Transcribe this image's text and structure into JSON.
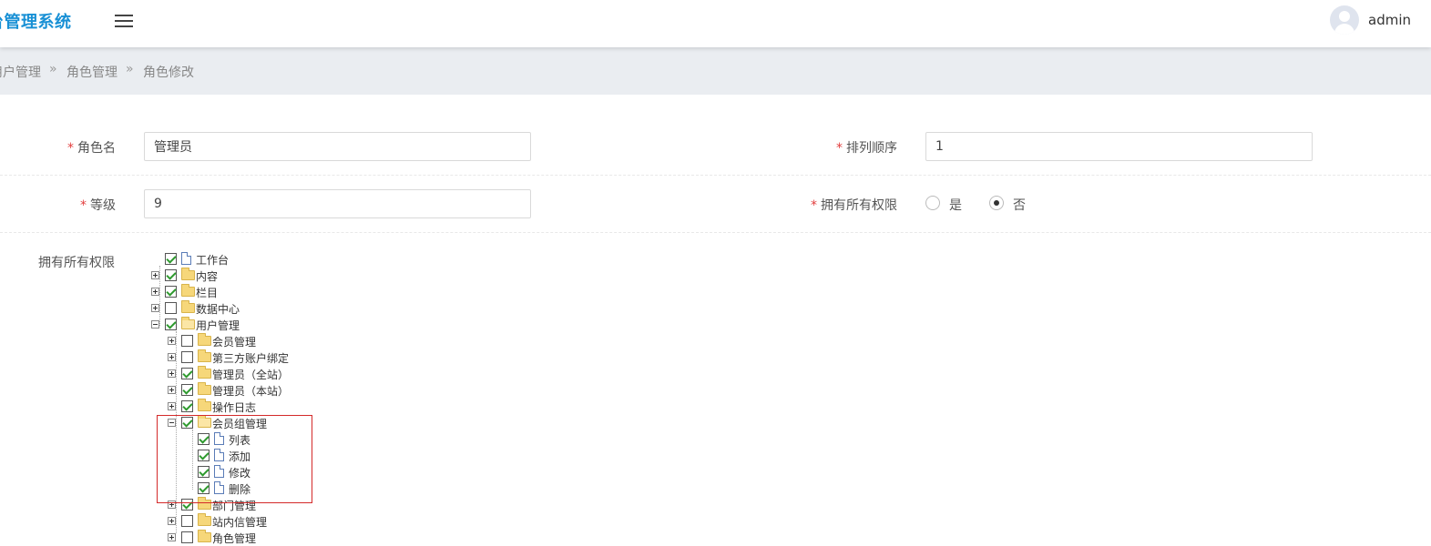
{
  "header": {
    "brand": "台管理系统",
    "username": "admin"
  },
  "breadcrumb": [
    "用户管理",
    "角色管理",
    "角色修改"
  ],
  "breadcrumb_sep": "»",
  "form": {
    "role_name": {
      "label": "角色名",
      "value": "管理员"
    },
    "sort_order": {
      "label": "排列顺序",
      "value": "1"
    },
    "level": {
      "label": "等级",
      "value": "9"
    },
    "all_perms": {
      "label": "拥有所有权限",
      "options": [
        "是",
        "否"
      ],
      "selected": "否"
    },
    "perm_tree_label": "拥有所有权限",
    "required_mark": "*"
  },
  "tree": {
    "nodes": [
      {
        "label": "工作台",
        "checked": true,
        "type": "file"
      },
      {
        "label": "内容",
        "checked": true,
        "type": "folder",
        "expanded": false
      },
      {
        "label": "栏目",
        "checked": true,
        "type": "folder",
        "expanded": false
      },
      {
        "label": "数据中心",
        "checked": false,
        "type": "folder",
        "expanded": false
      },
      {
        "label": "用户管理",
        "checked": true,
        "type": "folder",
        "expanded": true
      },
      {
        "label": "会员管理",
        "checked": false,
        "type": "folder",
        "expanded": false
      },
      {
        "label": "第三方账户绑定",
        "checked": false,
        "type": "folder",
        "expanded": false
      },
      {
        "label": "管理员（全站）",
        "checked": true,
        "type": "folder",
        "expanded": false
      },
      {
        "label": "管理员（本站）",
        "checked": true,
        "type": "folder",
        "expanded": false
      },
      {
        "label": "操作日志",
        "checked": true,
        "type": "folder",
        "expanded": false
      },
      {
        "label": "会员组管理",
        "checked": true,
        "type": "folder",
        "expanded": true
      },
      {
        "label": "列表",
        "checked": true,
        "type": "file"
      },
      {
        "label": "添加",
        "checked": true,
        "type": "file"
      },
      {
        "label": "修改",
        "checked": true,
        "type": "file"
      },
      {
        "label": "删除",
        "checked": true,
        "type": "file"
      },
      {
        "label": "部门管理",
        "checked": true,
        "type": "folder",
        "expanded": false
      },
      {
        "label": "站内信管理",
        "checked": false,
        "type": "folder",
        "expanded": false
      },
      {
        "label": "角色管理",
        "checked": false,
        "type": "folder",
        "expanded": false
      }
    ]
  }
}
